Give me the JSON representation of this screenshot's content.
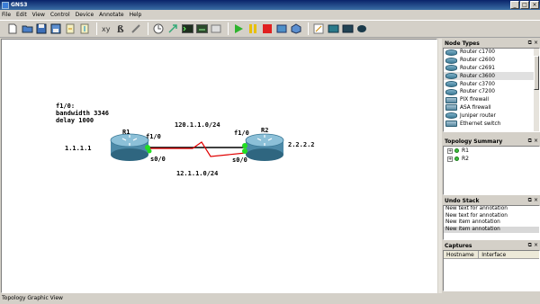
{
  "window": {
    "title": "GNS3",
    "buttons": {
      "minimize": "_",
      "maximize": "□",
      "close": "×"
    }
  },
  "menu": [
    "File",
    "Edit",
    "View",
    "Control",
    "Device",
    "Annotate",
    "Help"
  ],
  "toolbar": {
    "icons": [
      "new-file-icon",
      "open-folder-icon",
      "save-icon",
      "save-as-icon",
      "import-icon",
      "export-icon",
      "snap-icon",
      "toggle-labels-icon",
      "show-interface-labels-icon",
      "add-link-icon",
      "console-icon",
      "terminal-icon",
      "capture-icon",
      "start-icon",
      "pause-icon",
      "stop-icon",
      "reload-icon",
      "virtualbox-icon",
      "add-note-icon",
      "screenshot-icon",
      "ellipse-icon",
      "rectangle-icon"
    ]
  },
  "canvas": {
    "note": "f1/0:\nbandwidth 3346\ndelay 1000",
    "r1": {
      "label": "R1",
      "ip": "1.1.1.1",
      "if_fast": "f1/0",
      "if_serial": "s0/0"
    },
    "r2": {
      "label": "R2",
      "ip": "2.2.2.2",
      "if_fast": "f1/0",
      "if_serial": "s0/0"
    },
    "link_fast": "120.1.1.0/24",
    "link_serial": "12.1.1.0/24",
    "link_fast_color": "#000000",
    "link_serial_color": "#e00000",
    "port_color": "#22dd22"
  },
  "status": "Topology Graphic View",
  "panels": {
    "node_types": {
      "title": "Node Types",
      "items": [
        "Router c1700",
        "Router c2600",
        "Router c2691",
        "Router c3600",
        "Router c3700",
        "Router c7200",
        "PIX firewall",
        "ASA firewall",
        "Juniper router",
        "Ethernet switch"
      ],
      "selected": 3
    },
    "topology": {
      "title": "Topology Summary",
      "items": [
        "R1",
        "R2"
      ]
    },
    "undo": {
      "title": "Undo Stack",
      "items": [
        "New text for annotation",
        "New text for annotation",
        "New item annotation",
        "New item annotation"
      ],
      "selected": 3
    },
    "captures": {
      "title": "Captures",
      "columns": [
        "Hostname",
        "Interface"
      ]
    },
    "header_buttons": {
      "float": "⧉",
      "close": "×"
    }
  }
}
